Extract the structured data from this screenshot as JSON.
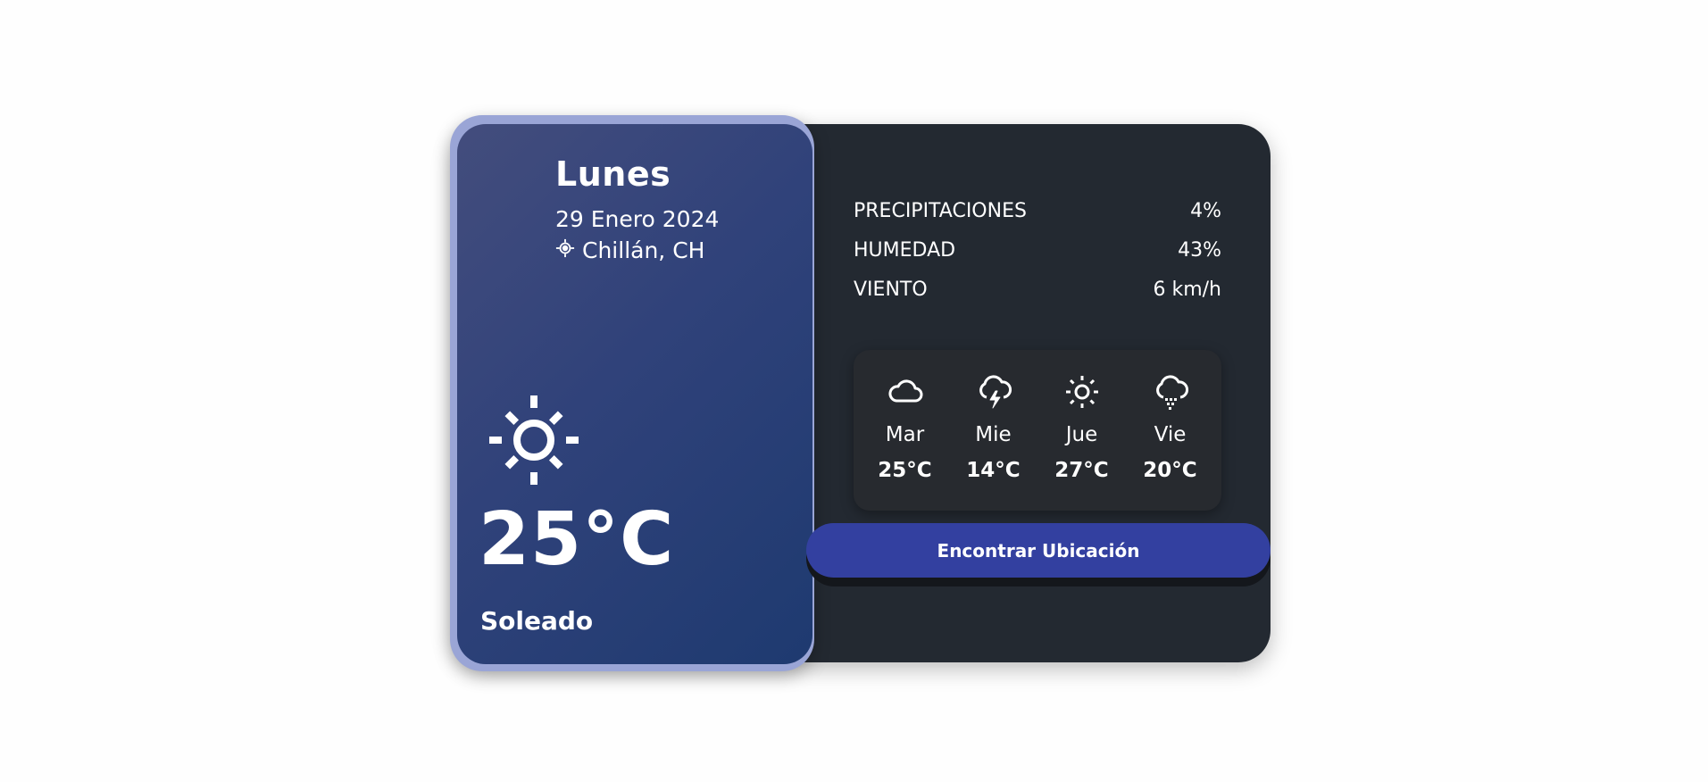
{
  "today": {
    "day": "Lunes",
    "date": "29 Enero 2024",
    "location": "Chillán, CH",
    "location_icon": "crosshair-icon",
    "weather_icon": "sun-icon",
    "temperature": "25°C",
    "condition": "Soleado"
  },
  "stats": [
    {
      "label": "PRECIPITACIONES",
      "value": "4%"
    },
    {
      "label": "HUMEDAD",
      "value": "43%"
    },
    {
      "label": "VIENTO",
      "value": "6 km/h"
    }
  ],
  "forecast": [
    {
      "day": "Mar",
      "temp": "25°C",
      "icon": "cloud-icon"
    },
    {
      "day": "Mie",
      "temp": "14°C",
      "icon": "thunderstorm-icon"
    },
    {
      "day": "Jue",
      "temp": "27°C",
      "icon": "sun-icon"
    },
    {
      "day": "Vie",
      "temp": "20°C",
      "icon": "snow-cloud-icon"
    }
  ],
  "button": {
    "label": "Encontrar Ubicación"
  },
  "colors": {
    "card_bg": "#232931",
    "left_gradient_start": "#434d7d",
    "left_gradient_end": "#1e3a70",
    "left_frame": "#9aa5d6",
    "button": "#3340a0"
  }
}
